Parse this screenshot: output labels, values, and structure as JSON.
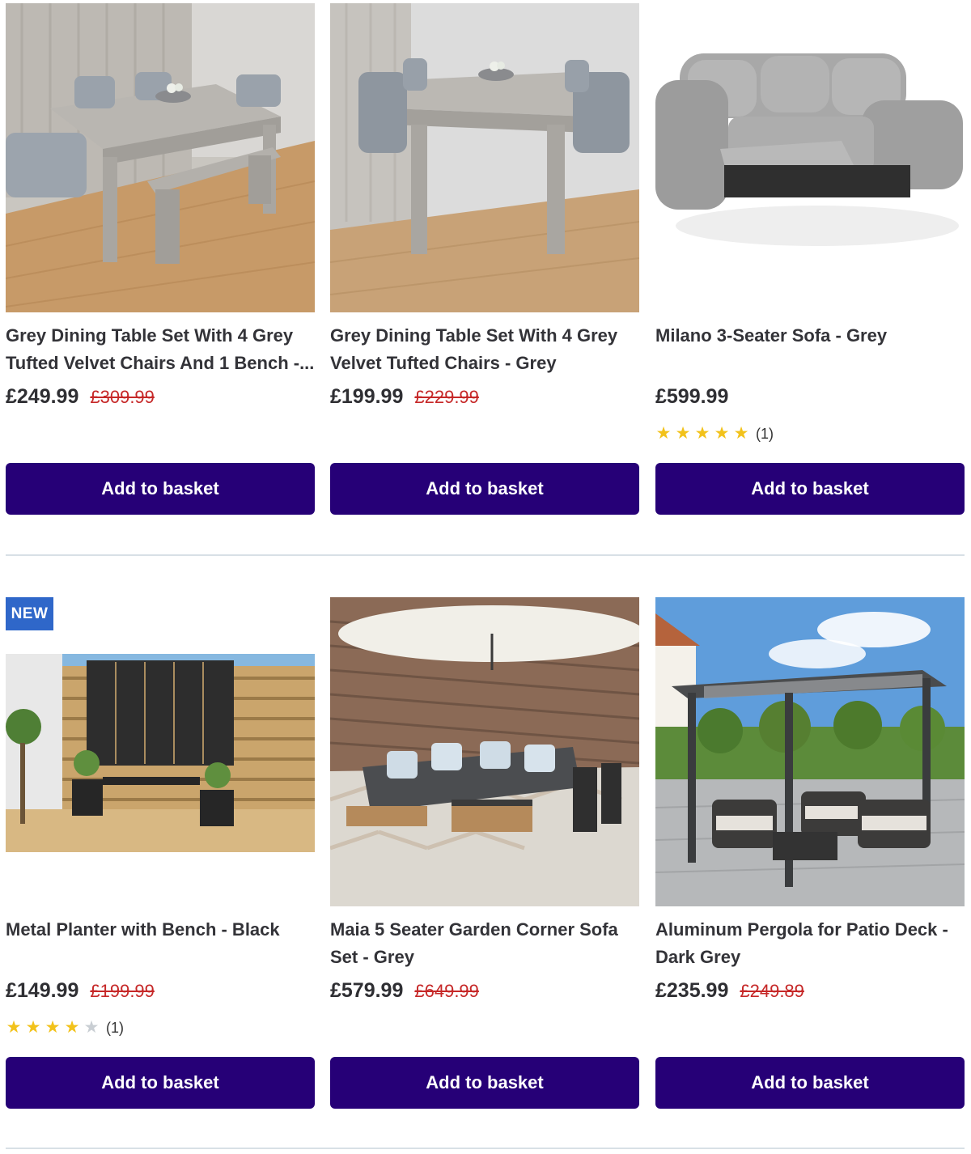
{
  "products": [
    {
      "title": "Grey Dining Table Set With 4 Grey Tufted Velvet Chairs And 1 Bench -...",
      "price": "£249.99",
      "was_price": "£309.99",
      "button": "Add to basket",
      "image_icon": "dining-set-with-bench-image"
    },
    {
      "title": "Grey Dining Table Set With 4 Grey Velvet Tufted Chairs - Grey",
      "price": "£199.99",
      "was_price": "£229.99",
      "button": "Add to basket",
      "image_icon": "dining-set-image"
    },
    {
      "title": "Milano 3-Seater Sofa - Grey",
      "price": "£599.99",
      "rating": 5,
      "rating_count": "(1)",
      "button": "Add to basket",
      "image_icon": "recliner-sofa-image"
    },
    {
      "badge": "NEW",
      "title": "Metal Planter with Bench - Black",
      "price": "£149.99",
      "was_price": "£199.99",
      "rating": 4,
      "rating_count": "(1)",
      "button": "Add to basket",
      "image_icon": "planter-bench-image"
    },
    {
      "title": "Maia 5 Seater Garden Corner Sofa Set - Grey",
      "price": "£579.99",
      "was_price": "£649.99",
      "button": "Add to basket",
      "image_icon": "garden-corner-sofa-image"
    },
    {
      "title": "Aluminum Pergola for Patio Deck - Dark Grey",
      "price": "£235.99",
      "was_price": "£249.89",
      "button": "Add to basket",
      "image_icon": "pergola-image"
    }
  ],
  "colors": {
    "button_bg": "#260077",
    "was_price": "#c62828",
    "badge_bg": "#2f67c9",
    "star_on": "#f2c21b",
    "star_off": "#c9ced3"
  }
}
